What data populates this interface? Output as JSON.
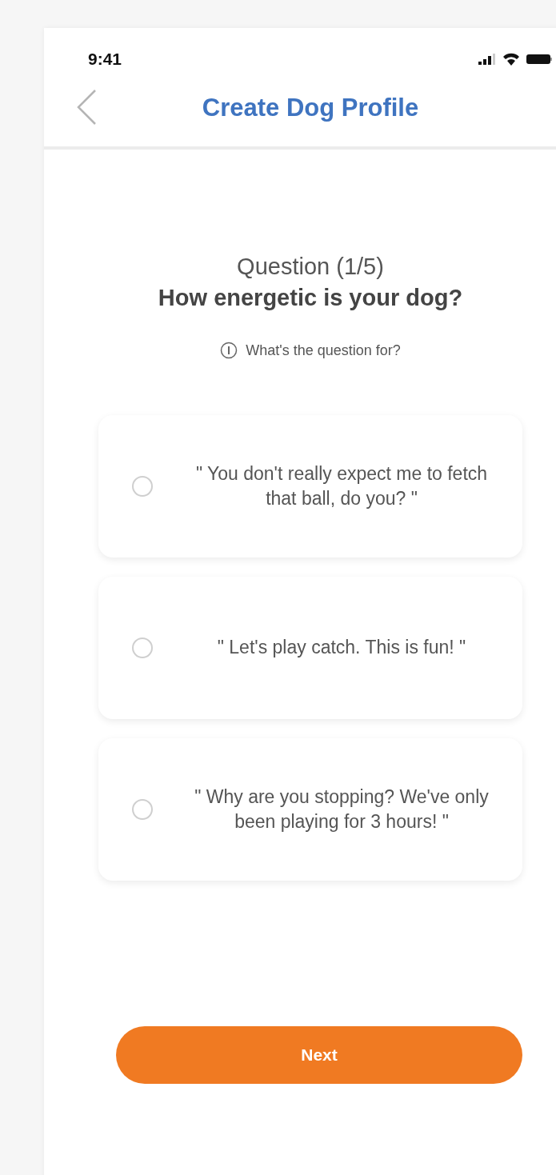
{
  "status_bar": {
    "time": "9:41"
  },
  "header": {
    "title": "Create Dog Profile"
  },
  "question": {
    "counter": "Question (1/5)",
    "text": "How energetic is your dog?",
    "info_link": "What's the question for?"
  },
  "options": [
    {
      "text": "\" You don't really expect me to fetch that ball, do you? \"",
      "selected": false
    },
    {
      "text": "\" Let's play catch. This is fun! \"",
      "selected": false
    },
    {
      "text": "\" Why are you stopping? We've only been playing for 3 hours! \"",
      "selected": false
    }
  ],
  "next_button": {
    "label": "Next"
  }
}
